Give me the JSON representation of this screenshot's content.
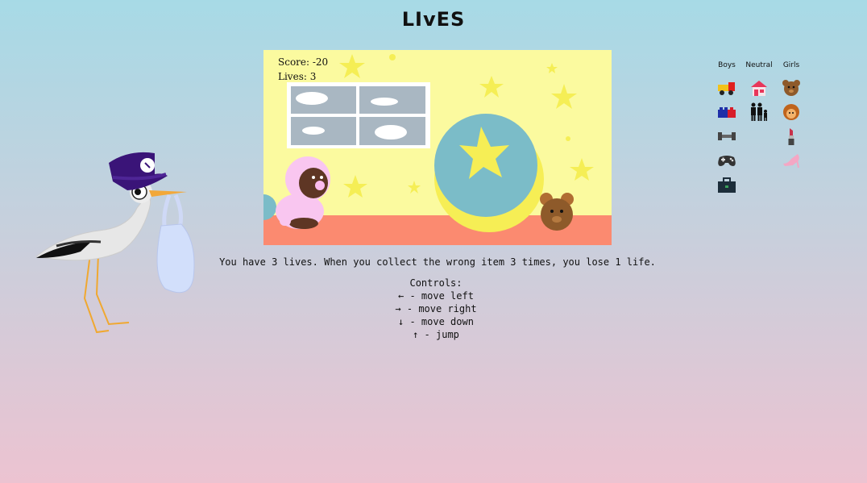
{
  "page_title": "LIvES",
  "hud": {
    "score": "Score: -20",
    "lives": "Lives: 3"
  },
  "description": "You have 3 lives. When you collect the wrong item 3 times, you lose 1 life.",
  "controls": {
    "title": "Controls:",
    "left": "← - move left",
    "right": "→ - move right",
    "down": "↓ - move down",
    "up": "↑ - jump"
  },
  "legend": {
    "headers": [
      "Boys",
      "Neutral",
      "Girls"
    ],
    "boys": [
      "toy-truck-icon",
      "lego-brick-icon",
      "dumbbell-icon",
      "gamepad-icon",
      "toolbox-icon"
    ],
    "neutral": [
      "house-icon",
      "family-icon"
    ],
    "girls": [
      "teddy-bear-icon",
      "doll-face-icon",
      "lipstick-icon",
      "high-heel-icon"
    ]
  },
  "colors": {
    "game_bg": "#fbfa9f",
    "floor": "#fb8a70",
    "star": "#f5ee55",
    "ball": "#7bbcc8"
  }
}
